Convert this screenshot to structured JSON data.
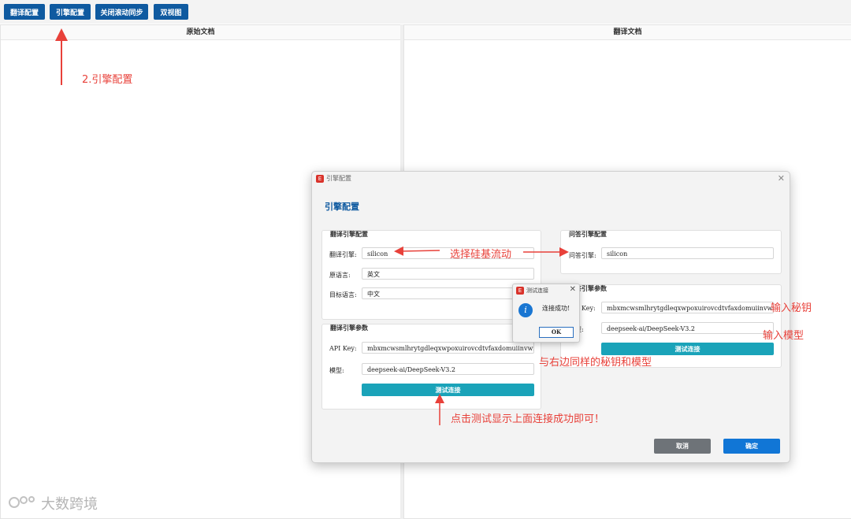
{
  "toolbar": {
    "buttons": [
      "翻译配置",
      "引擎配置",
      "关闭滚动同步",
      "双视图"
    ]
  },
  "panes": {
    "left_title": "原始文档",
    "right_title": "翻译文档"
  },
  "annotations": {
    "step2": "2.引擎配置",
    "select_engine": "选择硅基流动",
    "enter_key": "输入秘钥",
    "enter_model": "输入模型",
    "same_as_right": "与右边同样的秘钥和模型",
    "click_test": "点击测试显示上面连接成功即可！"
  },
  "dialog": {
    "window_title": "引擎配置",
    "heading": "引擎配置",
    "translate_engine": {
      "title": "翻译引擎配置",
      "engine_label": "翻译引擎:",
      "engine_value": "silicon",
      "source_label": "原语言:",
      "source_value": "英文",
      "target_label": "目标语言:",
      "target_value": "中文"
    },
    "translate_params": {
      "title": "翻译引擎参数",
      "key_label": "API Key:",
      "key_value": "mbxmcwsmlhrytgdleqxwpoxuirovcdtvfaxdomuiinvwzh",
      "model_label": "模型:",
      "model_value": "deepseek-ai/DeepSeek-V3.2",
      "test_button": "测试连接"
    },
    "qa_engine": {
      "title": "问答引擎配置",
      "engine_label": "问答引擎:",
      "engine_value": "silicon"
    },
    "qa_params": {
      "title": "问答引擎参数",
      "key_label": "Key:",
      "key_value": "mbxmcwsmlhrytgdleqxwpoxuirovcdtvfaxdomuiinvwzh",
      "model_label": "型:",
      "model_value": "deepseek-ai/DeepSeek-V3.2",
      "test_button": "测试连接"
    },
    "cancel_button": "取消",
    "ok_button": "确定"
  },
  "message_box": {
    "title": "测试连接",
    "text": "连接成功!",
    "ok": "OK"
  },
  "watermark": "大数跨境",
  "colors": {
    "toolbar_button": "#0f5aa0",
    "teal_button": "#1aa3b9",
    "cancel_button": "#6e7378",
    "ok_button": "#1176d6",
    "annotation": "#e8413a"
  },
  "icons": {
    "app": "app-logo-icon",
    "info": "info-icon",
    "close": "close-icon"
  }
}
